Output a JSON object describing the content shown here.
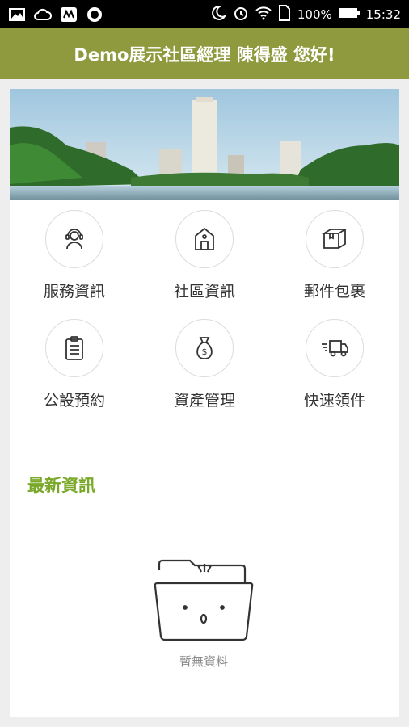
{
  "status_bar": {
    "left_icons": [
      "gallery-icon",
      "cloud-icon",
      "app-icon",
      "record-icon"
    ],
    "battery_percent": "100%",
    "time": "15:32"
  },
  "header": {
    "title": "Demo展示社區經理 陳得盛 您好!"
  },
  "menu": [
    {
      "label": "服務資訊",
      "icon": "headset-person-icon"
    },
    {
      "label": "社區資訊",
      "icon": "building-icon"
    },
    {
      "label": "郵件包裹",
      "icon": "package-icon"
    },
    {
      "label": "公設預約",
      "icon": "clipboard-icon"
    },
    {
      "label": "資產管理",
      "icon": "money-bag-icon"
    },
    {
      "label": "快速領件",
      "icon": "delivery-truck-icon"
    }
  ],
  "news": {
    "title": "最新資訊",
    "empty_text": "暫無資料"
  },
  "colors": {
    "header_bg": "#8e9a3d",
    "accent_green": "#7aa829"
  }
}
